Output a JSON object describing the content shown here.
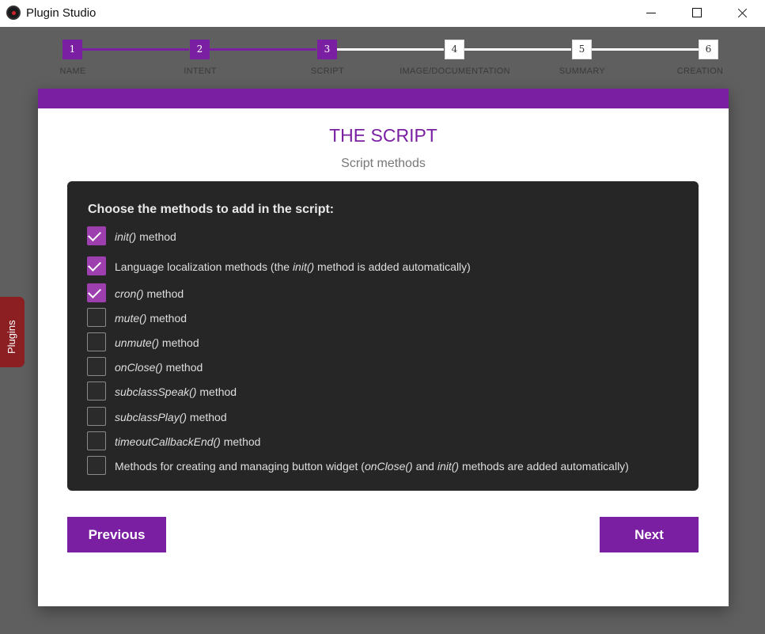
{
  "window": {
    "title": "Plugin Studio"
  },
  "stepper": {
    "steps": [
      {
        "number": "1",
        "label": "NAME",
        "state": "done"
      },
      {
        "number": "2",
        "label": "INTENT",
        "state": "done"
      },
      {
        "number": "3",
        "label": "SCRIPT",
        "state": "current"
      },
      {
        "number": "4",
        "label": "IMAGE/DOCUMENTATION",
        "state": "todo"
      },
      {
        "number": "5",
        "label": "SUMMARY",
        "state": "todo"
      },
      {
        "number": "6",
        "label": "CREATION",
        "state": "todo"
      }
    ]
  },
  "card": {
    "title": "THE SCRIPT",
    "subtitle": "Script methods",
    "heading": "Choose the methods to add in the script:",
    "options": [
      {
        "parts": [
          {
            "t": "init()",
            "i": true
          },
          {
            "t": " method"
          }
        ],
        "checked": true
      },
      {
        "parts": [
          {
            "t": "Language localization methods (the "
          },
          {
            "t": "init()",
            "i": true
          },
          {
            "t": " method is added automatically)"
          }
        ],
        "checked": true
      },
      {
        "parts": [
          {
            "t": "cron()",
            "i": true
          },
          {
            "t": " method"
          }
        ],
        "checked": true
      },
      {
        "parts": [
          {
            "t": "mute()",
            "i": true
          },
          {
            "t": " method"
          }
        ],
        "checked": false
      },
      {
        "parts": [
          {
            "t": "unmute()",
            "i": true
          },
          {
            "t": " method"
          }
        ],
        "checked": false
      },
      {
        "parts": [
          {
            "t": "onClose()",
            "i": true
          },
          {
            "t": " method"
          }
        ],
        "checked": false
      },
      {
        "parts": [
          {
            "t": "subclassSpeak()",
            "i": true
          },
          {
            "t": " method"
          }
        ],
        "checked": false
      },
      {
        "parts": [
          {
            "t": "subclassPlay()",
            "i": true
          },
          {
            "t": " method"
          }
        ],
        "checked": false
      },
      {
        "parts": [
          {
            "t": "timeoutCallbackEnd()",
            "i": true
          },
          {
            "t": " method"
          }
        ],
        "checked": false
      },
      {
        "parts": [
          {
            "t": "Methods for creating and managing button widget ("
          },
          {
            "t": "onClose()",
            "i": true
          },
          {
            "t": " and "
          },
          {
            "t": "init()",
            "i": true
          },
          {
            "t": " methods are added automatically)"
          }
        ],
        "checked": false
      }
    ],
    "previous_label": "Previous",
    "next_label": "Next"
  },
  "side_tab": {
    "label": "Plugins"
  },
  "colors": {
    "accent": "#7a1fa2",
    "checkbox": "#9d3fae",
    "panel": "#262626",
    "side_tab": "#8b1f22"
  }
}
